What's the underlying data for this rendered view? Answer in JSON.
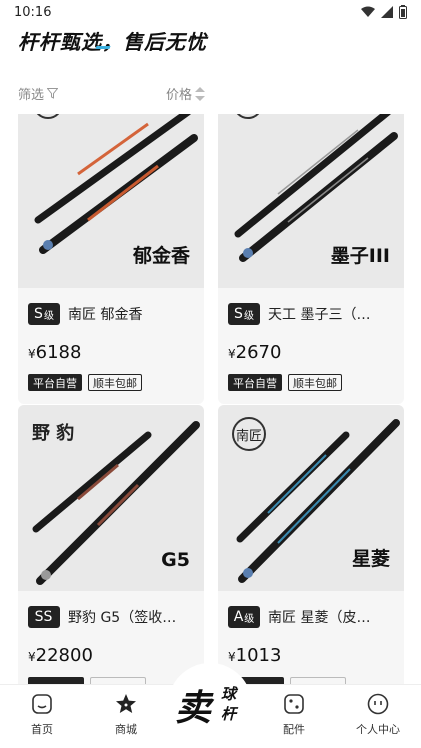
{
  "status": {
    "time": "10:16"
  },
  "header": {
    "slogan": "杆杆甄选，售后无忧"
  },
  "filters": {
    "screen_label": "筛选",
    "price_label": "价格"
  },
  "products": [
    {
      "brand_mark": "",
      "image_caption": "郁金香",
      "grade": "S",
      "grade_suffix": "级",
      "title": "南匠 郁金香",
      "currency": "¥",
      "price": "6188",
      "tags": [
        "平台自营",
        "顺丰包邮"
      ]
    },
    {
      "brand_mark": "",
      "image_caption": "墨子III",
      "grade": "S",
      "grade_suffix": "级",
      "title": "天工 墨子三（…",
      "currency": "¥",
      "price": "2670",
      "tags": [
        "平台自营",
        "顺丰包邮"
      ]
    },
    {
      "brand_mark": "野 豹",
      "image_caption": "G5",
      "grade": "SS",
      "grade_suffix": "",
      "title": "野豹 G5（签收…",
      "currency": "¥",
      "price": "22800",
      "tags": [
        "",
        ""
      ]
    },
    {
      "brand_mark": "南匠",
      "image_caption": "星菱",
      "grade": "A",
      "grade_suffix": "级",
      "title": "南匠 星菱（皮…",
      "currency": "¥",
      "price": "1013",
      "tags": [
        "",
        ""
      ]
    }
  ],
  "nav": {
    "home": "首页",
    "mall": "商城",
    "sell_big": "卖",
    "sell_small_1": "球",
    "sell_small_2": "杆",
    "parts": "配件",
    "profile": "个人中心"
  },
  "colors": {
    "accent": "#3ab0e0",
    "card_bg": "#f6f6f6",
    "dark": "#222222"
  },
  "icons": {
    "wifi": "wifi-icon",
    "signal": "signal-icon",
    "battery": "battery-icon",
    "filter": "filter-icon",
    "sort": "sort-icon",
    "home": "home-icon",
    "mall": "star-icon",
    "parts": "dice-icon",
    "profile": "smile-icon"
  }
}
